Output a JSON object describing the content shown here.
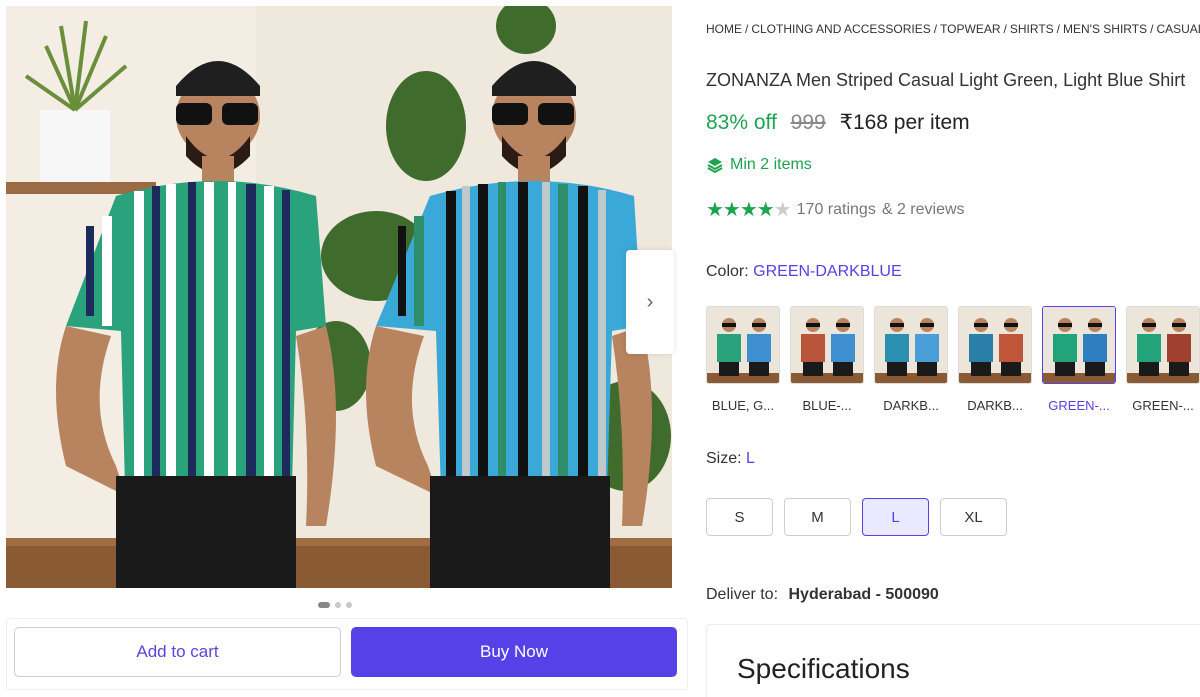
{
  "breadcrumb": [
    "HOME",
    "CLOTHING AND ACCESSORIES",
    "TOPWEAR",
    "SHIRTS",
    "MEN'S SHIRTS",
    "CASUAL SHIRTS"
  ],
  "breadcrumb_sep": "/",
  "product": {
    "title": "ZONANZA Men Striped Casual Light Green, Light Blue Shirt",
    "discount": "83% off",
    "mrp": "999",
    "price": "₹168 per item",
    "min_items": "Min 2 items",
    "stars": 4.5,
    "ratings": "170 ratings",
    "reviews": "& 2 reviews"
  },
  "color": {
    "label": "Color:",
    "selected": "GREEN-DARKBLUE",
    "options": [
      {
        "label": "BLUE, G...",
        "left": "#2aa37c",
        "right": "#3d8fd0"
      },
      {
        "label": "BLUE-...",
        "left": "#b8553a",
        "right": "#3d8fd0"
      },
      {
        "label": "DARKB...",
        "left": "#2a8fb0",
        "right": "#4a9fd8"
      },
      {
        "label": "DARKB...",
        "left": "#2a7fa8",
        "right": "#c0553a"
      },
      {
        "label": "GREEN-...",
        "left": "#22a37a",
        "right": "#2f7fc0"
      },
      {
        "label": "GREEN-...",
        "left": "#22a37a",
        "right": "#a0402f"
      }
    ],
    "selected_index": 4
  },
  "size": {
    "label": "Size:",
    "selected": "L",
    "options": [
      "S",
      "M",
      "L",
      "XL"
    ]
  },
  "delivery": {
    "label": "Deliver to:",
    "location": "Hyderabad - 500090"
  },
  "specifications": {
    "title": "Specifications"
  },
  "actions": {
    "add_to_cart": "Add to cart",
    "buy_now": "Buy Now"
  },
  "carousel": {
    "count": 3,
    "active": 0
  },
  "colors": {
    "accent": "#5641e8",
    "green": "#1ea34f"
  }
}
